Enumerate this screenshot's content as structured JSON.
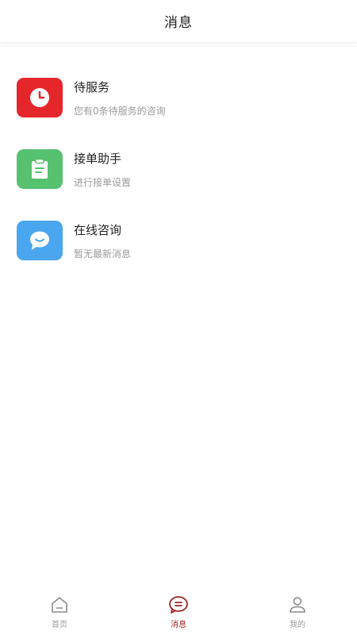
{
  "header": {
    "title": "消息"
  },
  "items": [
    {
      "title": "待服务",
      "subtitle": "您有0条待服务的咨询",
      "icon": "clock-icon",
      "color": "#e5262b"
    },
    {
      "title": "接单助手",
      "subtitle": "进行接单设置",
      "icon": "clipboard-icon",
      "color": "#56c270"
    },
    {
      "title": "在线咨询",
      "subtitle": "暂无最新消息",
      "icon": "chat-bubble-icon",
      "color": "#4aa6ee"
    }
  ],
  "tabbar": {
    "tabs": [
      {
        "label": "首页",
        "icon": "home-icon",
        "active": false
      },
      {
        "label": "消息",
        "icon": "message-icon",
        "active": true
      },
      {
        "label": "我的",
        "icon": "user-icon",
        "active": false
      }
    ],
    "active_color": "#a32424",
    "inactive_color": "#9a9a9a"
  }
}
